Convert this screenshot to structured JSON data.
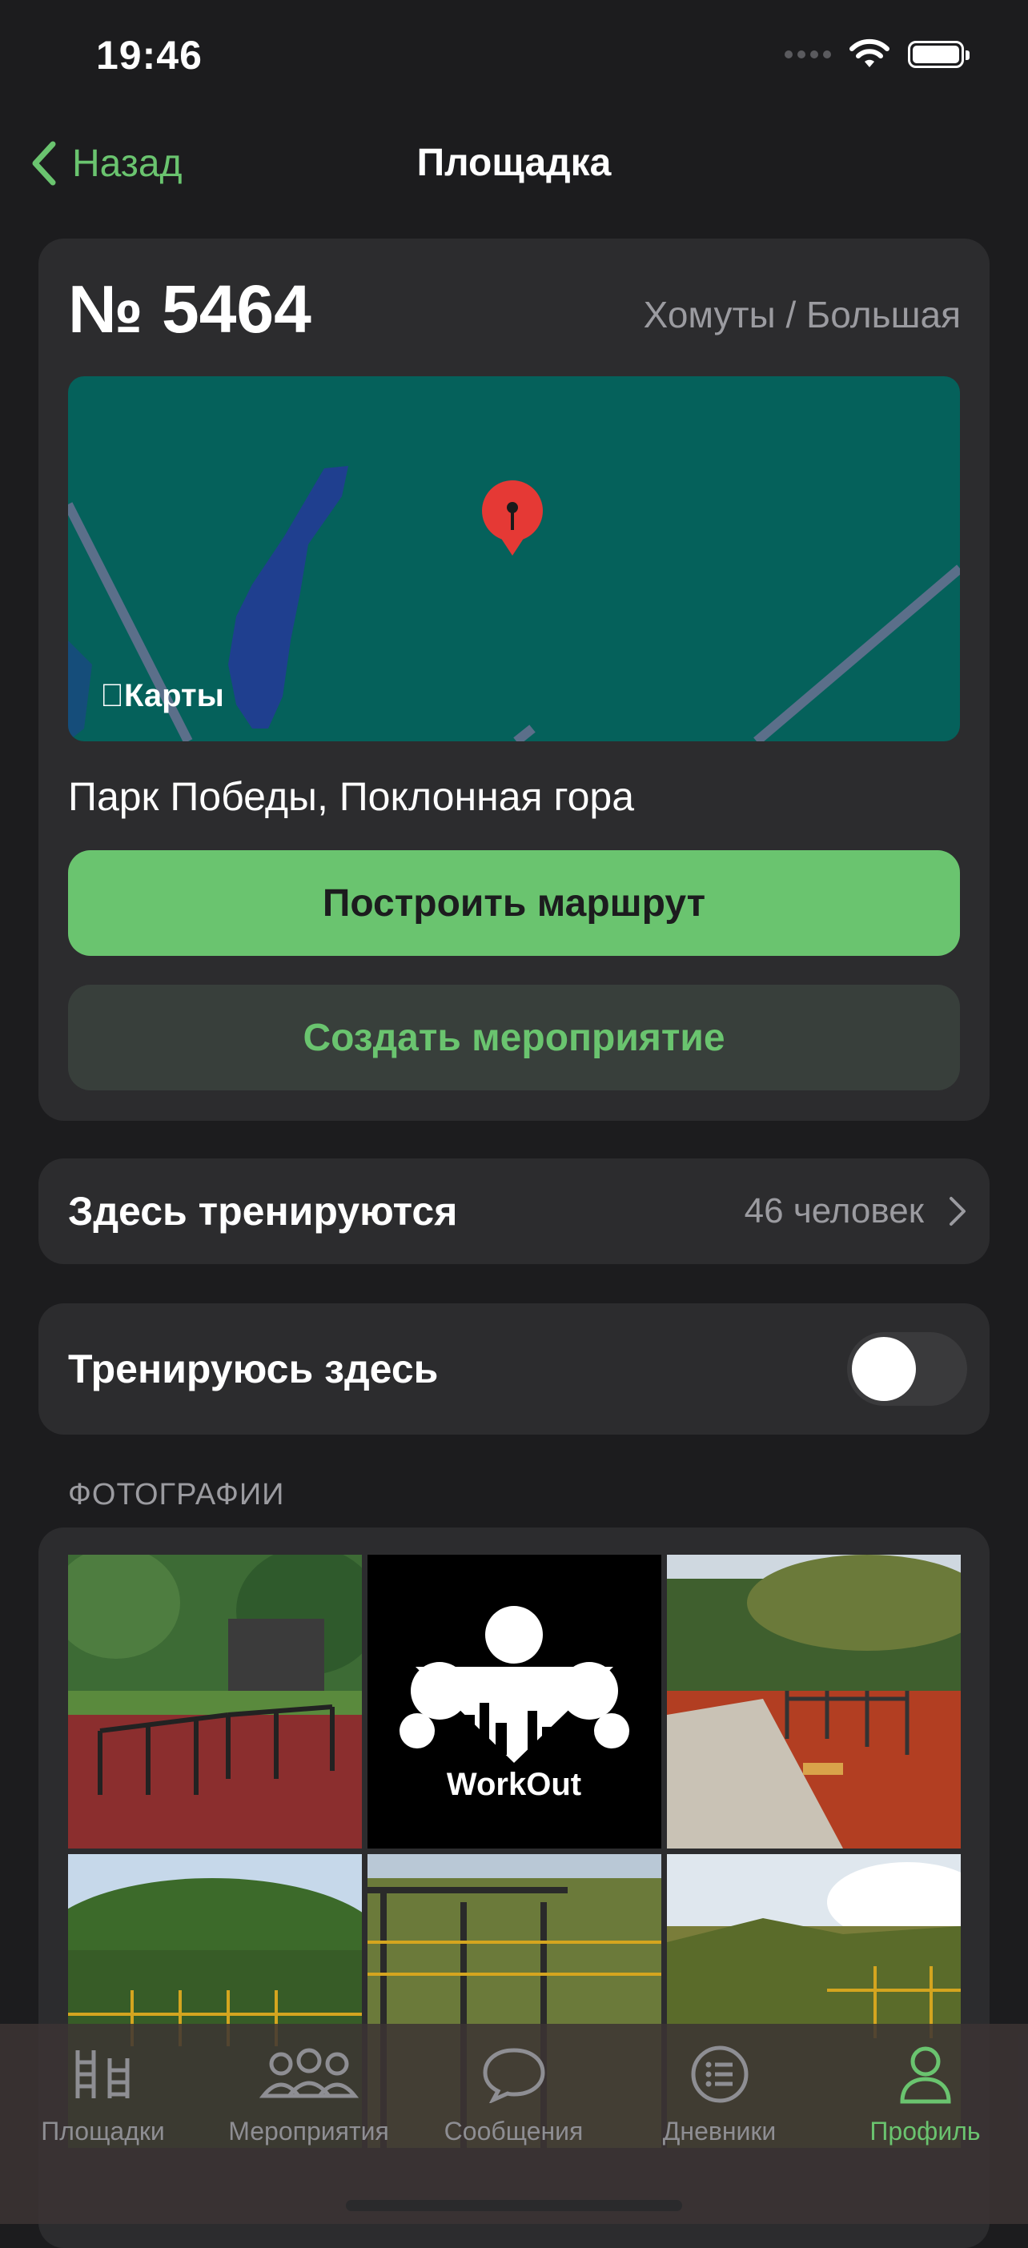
{
  "status": {
    "time": "19:46"
  },
  "nav": {
    "back_label": "Назад",
    "title": "Площадка"
  },
  "park": {
    "number": "№ 5464",
    "type": "Хомуты / Большая",
    "maps_label": "Карты",
    "address": "Парк Победы, Поклонная гора",
    "route_button": "Построить маршрут",
    "event_button": "Создать мероприятие"
  },
  "trainers": {
    "label": "Здесь тренируются",
    "count": "46 человек"
  },
  "train_here": {
    "label": "Тренируюсь здесь",
    "toggle_on": false
  },
  "photos": {
    "section_title": "ФОТОГРАФИИ",
    "logo_text": "WorkOut"
  },
  "tabbar": {
    "items": [
      {
        "label": "Площадки",
        "icon": "ladder-icon"
      },
      {
        "label": "Мероприятия",
        "icon": "people-icon"
      },
      {
        "label": "Сообщения",
        "icon": "chat-bubble-icon"
      },
      {
        "label": "Дневники",
        "icon": "list-icon"
      },
      {
        "label": "Профиль",
        "icon": "person-icon"
      }
    ],
    "active_index": 4
  },
  "colors": {
    "accent": "#6ac46f",
    "background": "#1c1c1e",
    "card": "#2c2c2e",
    "map": "#05615b"
  }
}
